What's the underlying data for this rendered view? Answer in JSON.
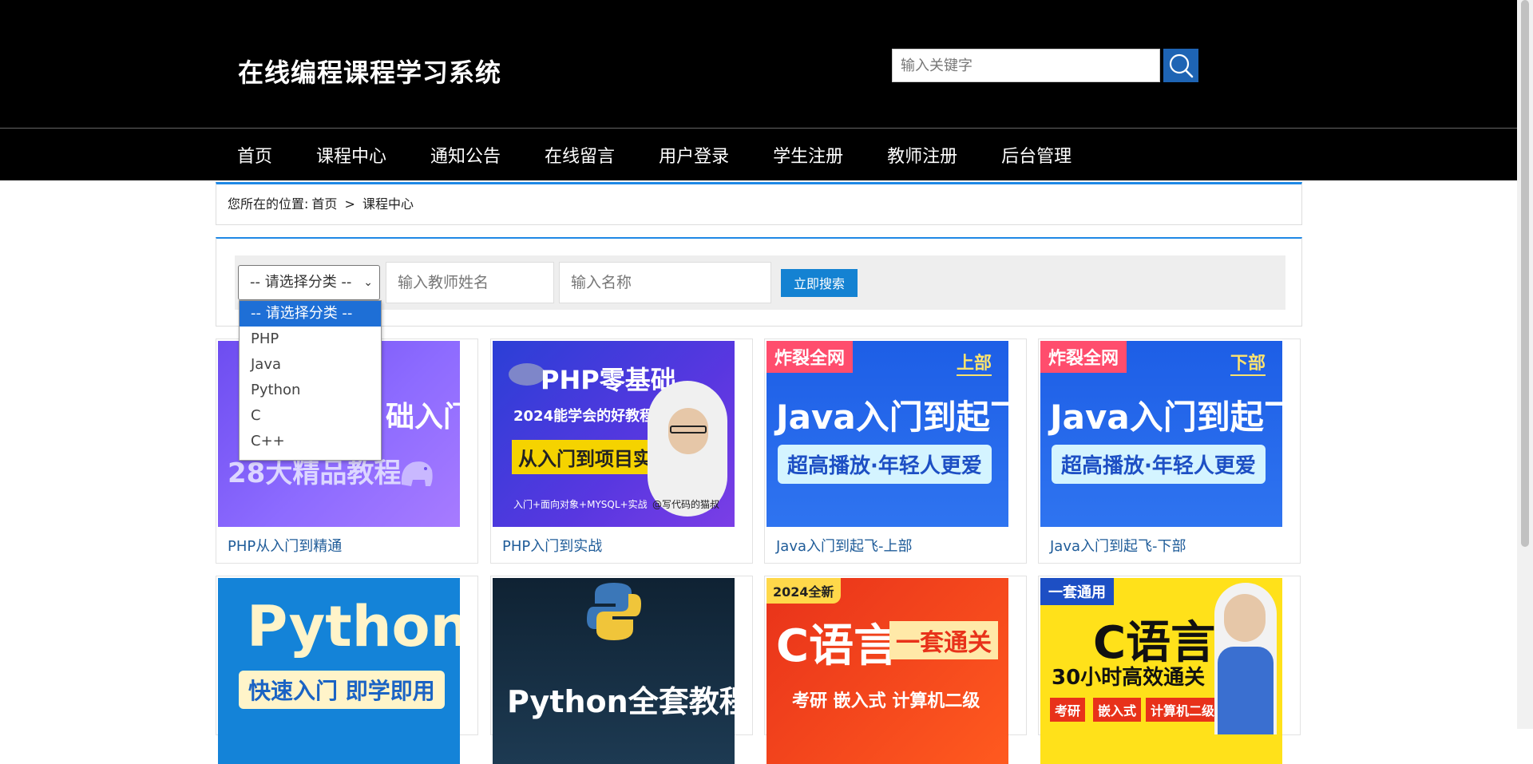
{
  "header": {
    "site_title": "在线编程课程学习系统",
    "search_placeholder": "输入关键字",
    "nav": [
      "首页",
      "课程中心",
      "通知公告",
      "在线留言",
      "用户登录",
      "学生注册",
      "教师注册",
      "后台管理"
    ]
  },
  "breadcrumb": {
    "prefix": "您所在的位置:",
    "home": "首页",
    "sep": ">",
    "current": "课程中心"
  },
  "filter": {
    "category_selected": "-- 请选择分类 --",
    "category_options": [
      "-- 请选择分类 --",
      "PHP",
      "Java",
      "Python",
      "C",
      "C++"
    ],
    "teacher_placeholder": "输入教师姓名",
    "name_placeholder": "输入名称",
    "search_button": "立即搜索"
  },
  "courses": [
    {
      "title": "PHP从入门到精通",
      "banner": [
        "础入门",
        "28大精品教程"
      ]
    },
    {
      "title": "PHP入门到实战",
      "banner": [
        "PHP零基础",
        "2024能学会的好教程",
        "从入门到项目实战",
        "入门+面向对象+MYSQL+实战",
        "@写代码的猫叔"
      ]
    },
    {
      "title": "Java入门到起飞-上部",
      "banner": [
        "炸裂全网",
        "上部",
        "Java入门到起飞",
        "超高播放·年轻人更爱"
      ]
    },
    {
      "title": "Java入门到起飞-下部",
      "banner": [
        "炸裂全网",
        "下部",
        "Java入门到起飞",
        "超高播放·年轻人更爱"
      ]
    },
    {
      "title": "",
      "banner": [
        "Python",
        "快速入门 即学即用"
      ]
    },
    {
      "title": "",
      "banner": [
        "Python全套教程"
      ]
    },
    {
      "title": "",
      "banner": [
        "2024全新",
        "C语言",
        "一套通关",
        "考研 嵌入式 计算机二级"
      ]
    },
    {
      "title": "",
      "banner": [
        "一套通用",
        "C语言",
        "30小时高效通关",
        "考研",
        "嵌入式",
        "计算机二级"
      ]
    }
  ],
  "colors": {
    "header_bg": "#000000",
    "accent": "#1e88e5",
    "button": "#1482d2",
    "link": "#1f5c99"
  }
}
